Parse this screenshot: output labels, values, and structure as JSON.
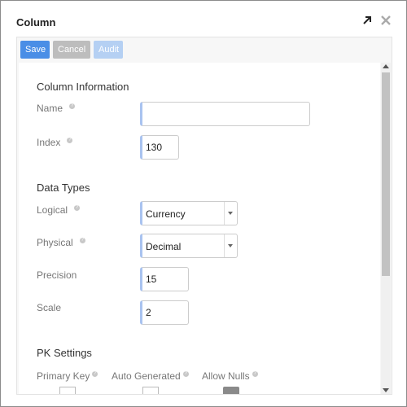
{
  "dialog": {
    "title": "Column"
  },
  "toolbar": {
    "save_label": "Save",
    "cancel_label": "Cancel",
    "audit_label": "Audit"
  },
  "column_information": {
    "heading": "Column Information",
    "name_label": "Name",
    "name_value": "",
    "index_label": "Index",
    "index_value": "130"
  },
  "data_types": {
    "heading": "Data Types",
    "logical_label": "Logical",
    "logical_value": "Currency",
    "physical_label": "Physical",
    "physical_value": "Decimal",
    "precision_label": "Precision",
    "precision_value": "15",
    "scale_label": "Scale",
    "scale_value": "2"
  },
  "pk_settings": {
    "heading": "PK Settings",
    "primary_key_label": "Primary Key",
    "auto_generated_label": "Auto Generated",
    "allow_nulls_label": "Allow Nulls"
  },
  "help_glyph": "?",
  "colors": {
    "save": "#4a8ee6",
    "cancel": "#bdbdbd",
    "audit_disabled": "#b5d0f3",
    "input_accent": "#a9c3f0"
  }
}
